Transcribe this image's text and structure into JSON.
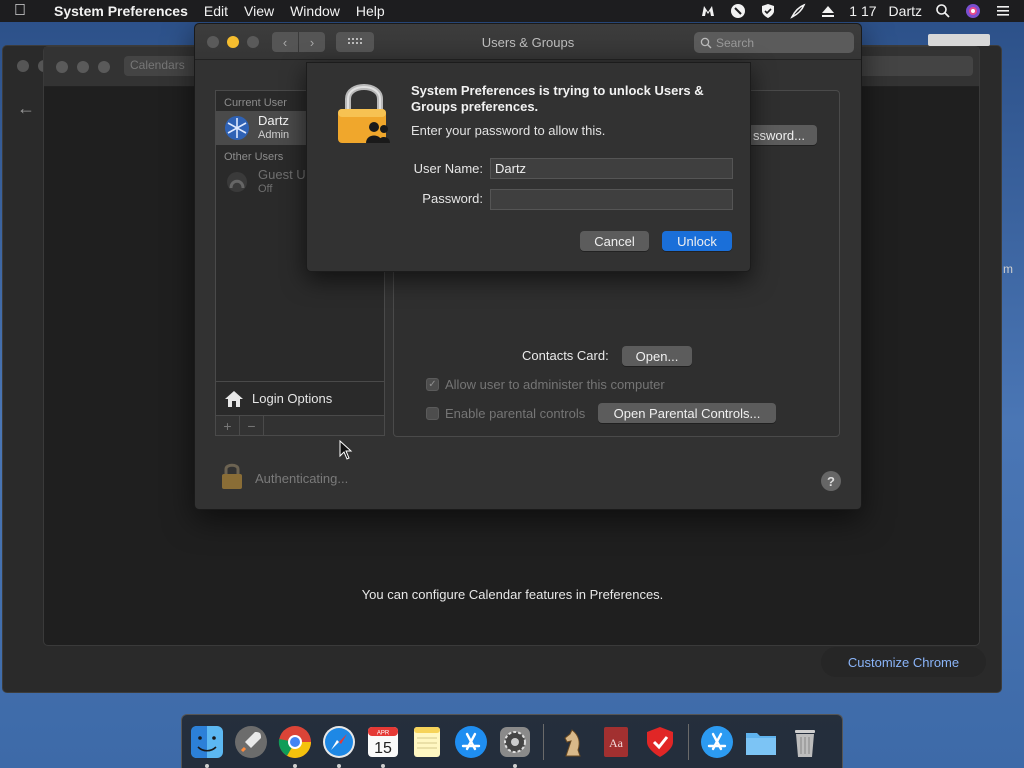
{
  "menubar": {
    "app_name": "System Preferences",
    "items": [
      "Edit",
      "View",
      "Window",
      "Help"
    ],
    "clock": "1 17",
    "user": "Dartz"
  },
  "background": {
    "calendar_chip": "Calendars",
    "calendar_message": "You can configure Calendar features in Preferences.",
    "customize_chrome": "Customize Chrome",
    "side_fragment": "m"
  },
  "window": {
    "title": "Users & Groups",
    "search_placeholder": "Search",
    "current_user_header": "Current User",
    "current_user": {
      "name": "Dartz",
      "role": "Admin"
    },
    "other_users_header": "Other Users",
    "guest_user": {
      "name": "Guest U",
      "role": "Off"
    },
    "login_options": "Login Options",
    "add_label": "+",
    "remove_label": "−",
    "password_button": "ssword...",
    "contacts_card_label": "Contacts Card:",
    "open_button": "Open...",
    "allow_admin_label": "Allow user to administer this computer",
    "parental_label": "Enable parental controls",
    "parental_button": "Open Parental Controls...",
    "authenticating": "Authenticating...",
    "help": "?"
  },
  "dialog": {
    "title": "System Preferences is trying to unlock Users & Groups preferences.",
    "subtitle": "Enter your password to allow this.",
    "username_label": "User Name:",
    "username_value": "Dartz",
    "password_label": "Password:",
    "password_value": "",
    "cancel": "Cancel",
    "unlock": "Unlock"
  },
  "dock": {
    "items": [
      "finder",
      "launchpad",
      "chrome",
      "safari",
      "calendar",
      "notes",
      "app-store",
      "system-preferences",
      "chess",
      "dictionary",
      "antivirus",
      "app-store-downloads",
      "folder",
      "trash"
    ],
    "calendar_month": "APR",
    "calendar_day": "15",
    "dictionary_text": "Aa"
  },
  "colors": {
    "accent": "#1a6fd9",
    "traffic_yellow": "#f5bd2f",
    "link_blue": "#8ab4f8"
  }
}
